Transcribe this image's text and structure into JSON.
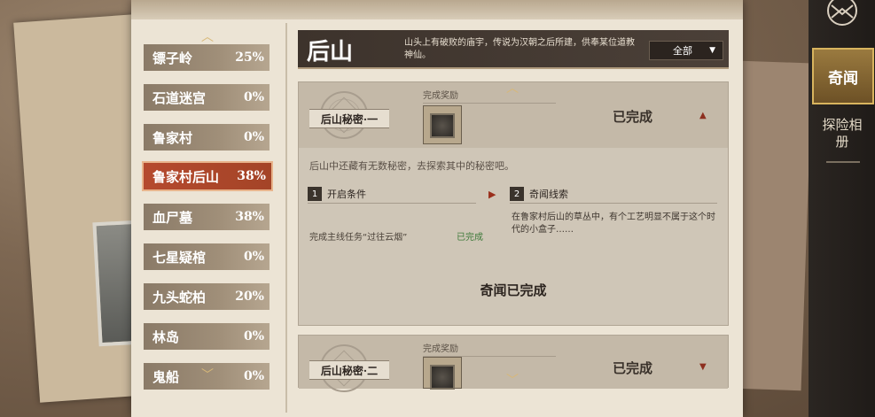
{
  "locations": [
    {
      "name": "镖子岭",
      "pct": "25%"
    },
    {
      "name": "石道迷宫",
      "pct": "0%"
    },
    {
      "name": "鲁家村",
      "pct": "0%"
    },
    {
      "name": "鲁家村后山",
      "pct": "38%",
      "active": true
    },
    {
      "name": "血尸墓",
      "pct": "38%"
    },
    {
      "name": "七星疑棺",
      "pct": "0%"
    },
    {
      "name": "九头蛇柏",
      "pct": "20%"
    },
    {
      "name": "林岛",
      "pct": "0%"
    },
    {
      "name": "鬼船",
      "pct": "0%"
    }
  ],
  "header": {
    "title": "后山",
    "description": "山头上有破败的庙宇，传说为汉朝之后所建，供奉某位道教神仙。",
    "filter_value": "全部"
  },
  "cards": [
    {
      "secret_label": "后山秘密·一",
      "reward_label": "完成奖励",
      "status": "已完成",
      "intro": "后山中还藏有无数秘密，去探索其中的秘密吧。",
      "step1_num": "1",
      "step1_label": "开启条件",
      "step2_num": "2",
      "step2_label": "奇闻线索",
      "condition": "完成主线任务“过往云烟”",
      "condition_status": "已完成",
      "clue": "在鲁家村后山的草丛中，有个工艺明显不属于这个时代的小盒子……",
      "complete_text": "奇闻已完成"
    },
    {
      "secret_label": "后山秘密·二",
      "reward_label": "完成奖励",
      "status": "已完成"
    }
  ],
  "menu": {
    "active_tab": "奇闻",
    "tab2": "探险相册"
  },
  "colors": {
    "accent_red": "#b54a2e",
    "gold": "#d8b878",
    "green_done": "#3e7a3a"
  }
}
